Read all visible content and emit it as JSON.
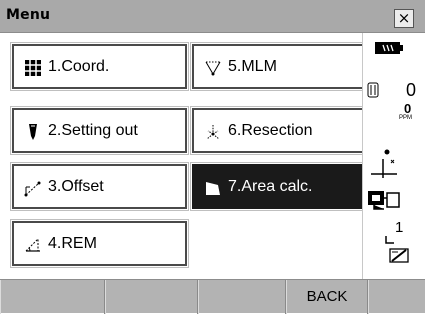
{
  "window": {
    "title": "Menu",
    "close_glyph": "×"
  },
  "menu": {
    "items": [
      {
        "label": "1.Coord.",
        "icon": "coord-grid-icon"
      },
      {
        "label": "2.Setting out",
        "icon": "setting-out-stake-icon"
      },
      {
        "label": "3.Offset",
        "icon": "offset-icon"
      },
      {
        "label": "4.REM",
        "icon": "rem-triangle-icon"
      },
      {
        "label": "5.MLM",
        "icon": "mlm-icon"
      },
      {
        "label": "6.Resection",
        "icon": "resection-icon"
      },
      {
        "label": "7.Area calc.",
        "icon": "area-calc-icon",
        "selected": true
      }
    ]
  },
  "status": {
    "battery_icon": "battery-icon",
    "prism_constant": "0",
    "ppm_value": "0",
    "ppm_unit": "PPM",
    "target_icon": "target-point-icon",
    "instrument_icon": "instrument-icon",
    "comm_icon": "communication-icon",
    "page_number": "1",
    "input_mode_icon": "input-mode-icon"
  },
  "softkeys": [
    "",
    "",
    "",
    "BACK",
    ""
  ]
}
